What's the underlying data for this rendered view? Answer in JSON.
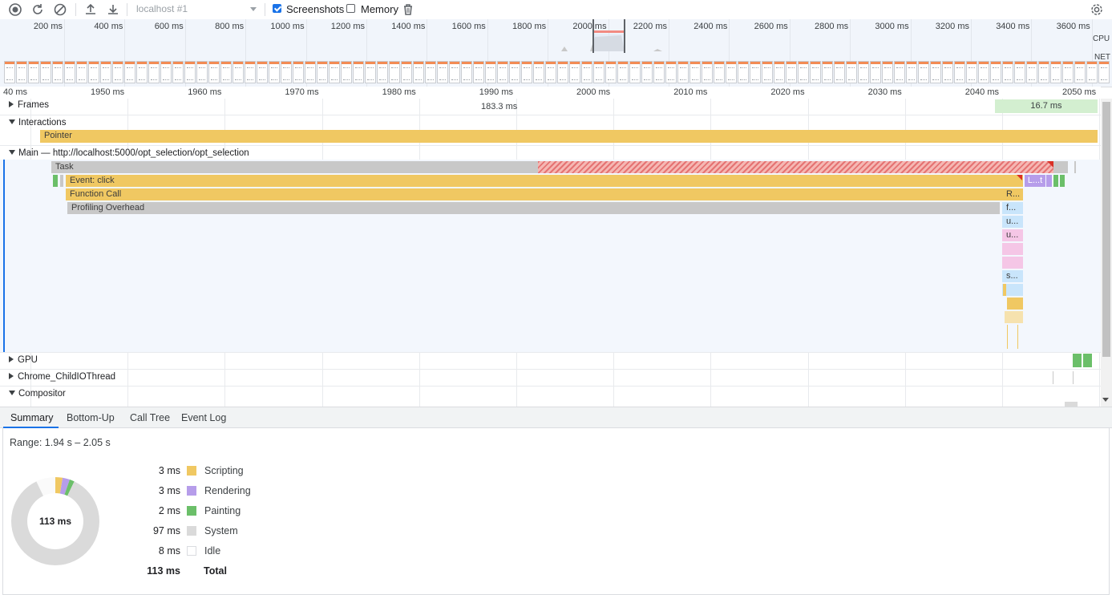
{
  "toolbar": {
    "target": "localhost #1",
    "screenshots_label": "Screenshots",
    "screenshots_checked": true,
    "memory_label": "Memory",
    "memory_checked": false
  },
  "overview": {
    "tick_labels": [
      "200 ms",
      "400 ms",
      "600 ms",
      "800 ms",
      "1000 ms",
      "1200 ms",
      "1400 ms",
      "1600 ms",
      "1800 ms",
      "2000 ms",
      "2200 ms",
      "2400 ms",
      "2600 ms",
      "2800 ms",
      "3000 ms",
      "3200 ms",
      "3400 ms",
      "3600 ms"
    ],
    "cpu_label": "CPU",
    "net_label": "NET"
  },
  "ruler": {
    "labels": [
      "40 ms",
      "1950 ms",
      "1960 ms",
      "1970 ms",
      "1980 ms",
      "1990 ms",
      "2000 ms",
      "2010 ms",
      "2020 ms",
      "2030 ms",
      "2040 ms",
      "2050 ms"
    ]
  },
  "tracks": {
    "frames": {
      "title": "Frames",
      "frame1": "183.3 ms",
      "frame2": "16.7 ms"
    },
    "interactions": {
      "title": "Interactions",
      "pointer": "Pointer"
    },
    "main": {
      "title": "Main — http://localhost:5000/opt_selection/opt_selection",
      "task": "Task",
      "event_click": "Event: click",
      "function_call": "Function Call",
      "profiling_overhead": "Profiling Overhead",
      "r_short": "R...",
      "f_short": "f...",
      "u_short": "u...",
      "u2_short": "u...",
      "s_short": "s...",
      "lt_short": "L...t"
    },
    "gpu": {
      "title": "GPU"
    },
    "childio": {
      "title": "Chrome_ChildIOThread"
    },
    "compositor": {
      "title": "Compositor"
    }
  },
  "tabs": [
    "Summary",
    "Bottom-Up",
    "Call Tree",
    "Event Log"
  ],
  "summary": {
    "range": "Range: 1.94 s – 2.05 s",
    "total_center": "113 ms",
    "legend": [
      {
        "value": "3 ms",
        "label": "Scripting",
        "color": "#f0c862"
      },
      {
        "value": "3 ms",
        "label": "Rendering",
        "color": "#b69dea"
      },
      {
        "value": "2 ms",
        "label": "Painting",
        "color": "#6bbf69"
      },
      {
        "value": "97 ms",
        "label": "System",
        "color": "#dadada"
      },
      {
        "value": "8 ms",
        "label": "Idle",
        "color": "#ffffff"
      }
    ],
    "total_value": "113 ms",
    "total_label": "Total"
  }
}
